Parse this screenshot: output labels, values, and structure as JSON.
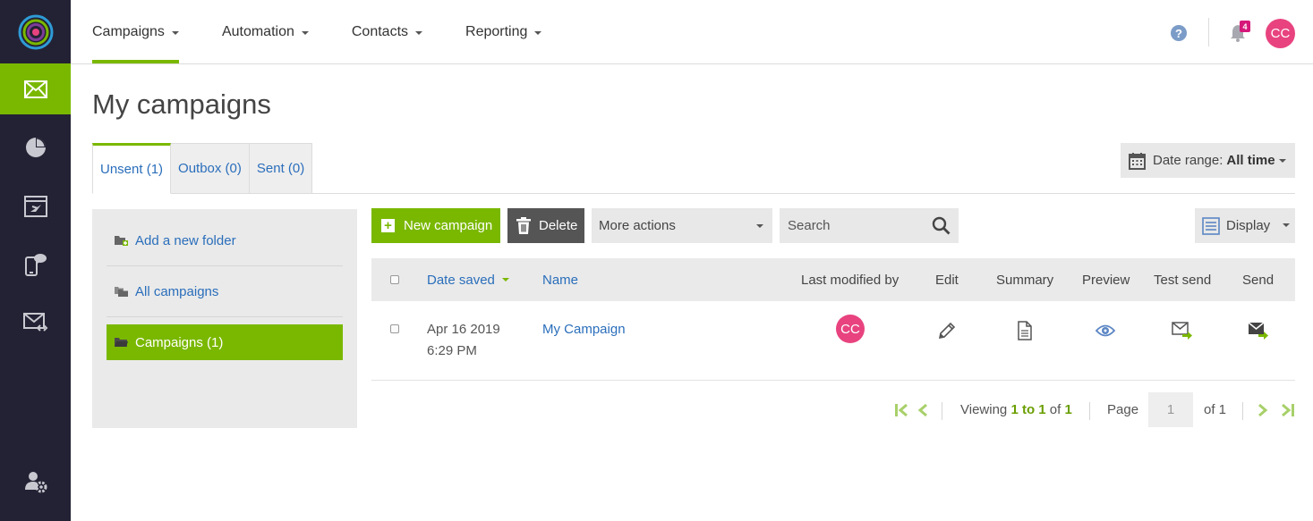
{
  "nav": {
    "items": [
      {
        "label": "Campaigns"
      },
      {
        "label": "Automation"
      },
      {
        "label": "Contacts"
      },
      {
        "label": "Reporting"
      }
    ],
    "notifications_count": "4",
    "user_initials": "CC"
  },
  "page": {
    "title": "My campaigns",
    "tabs": [
      {
        "label": "Unsent (1)"
      },
      {
        "label": "Outbox (0)"
      },
      {
        "label": "Sent (0)"
      }
    ],
    "date_range_label": "Date range:",
    "date_range_value": "All time"
  },
  "folders": {
    "add": "Add a new folder",
    "all": "All campaigns",
    "current": "Campaigns (1)"
  },
  "toolbar": {
    "new_campaign": "New campaign",
    "delete": "Delete",
    "more_actions": "More actions",
    "search_placeholder": "Search",
    "display": "Display"
  },
  "table": {
    "columns": {
      "date_saved": "Date saved",
      "name": "Name",
      "last_modified_by": "Last modified by",
      "edit": "Edit",
      "summary": "Summary",
      "preview": "Preview",
      "test_send": "Test send",
      "send": "Send"
    },
    "rows": [
      {
        "date": "Apr 16 2019",
        "time": "6:29 PM",
        "name": "My Campaign",
        "modified_by": "CC"
      }
    ]
  },
  "pagination": {
    "viewing_prefix": "Viewing",
    "range": "1 to 1",
    "of_label": "of",
    "total": "1",
    "page_label": "Page",
    "page_value": "1",
    "of_pages": "of 1"
  },
  "colors": {
    "accent": "#7ab800",
    "rail": "#232234",
    "link": "#2a6ebb",
    "avatar": "#e8437f",
    "badge": "#d6187a"
  },
  "icons": [
    "logo-icon",
    "envelope-icon",
    "pie-chart-icon",
    "landing-page-icon",
    "mobile-sms-icon",
    "email-code-icon",
    "user-settings-icon",
    "help-icon",
    "bell-icon",
    "calendar-icon",
    "folder-add-icon",
    "folders-icon",
    "folder-icon",
    "plus-icon",
    "trash-icon",
    "search-icon",
    "display-list-icon",
    "pencil-icon",
    "document-icon",
    "eye-icon",
    "test-send-icon",
    "send-icon",
    "first-page-icon",
    "prev-page-icon",
    "next-page-icon",
    "last-page-icon"
  ]
}
